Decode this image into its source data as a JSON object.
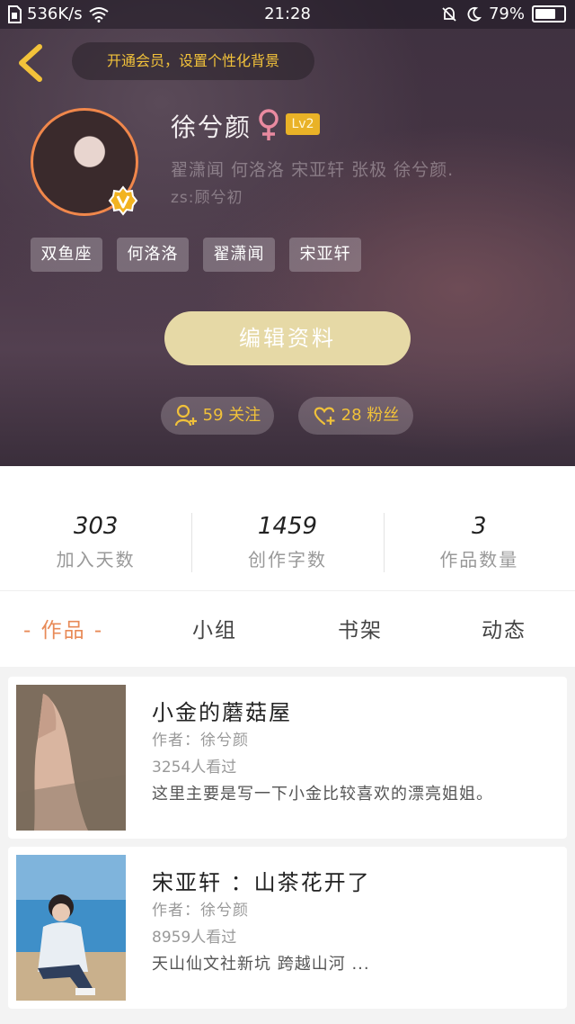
{
  "status_bar": {
    "speed": "536K/s",
    "time": "21:28",
    "battery": "79%",
    "battery_level": 0.79
  },
  "header": {
    "vip_text": "开通会员，设置个性化背景"
  },
  "profile": {
    "name": "徐兮颜",
    "level": "Lv2",
    "signature_line1": "翟潇闻 何洛洛 宋亚轩 张极 徐兮颜.",
    "signature_line2": "zs:顾兮初",
    "tags": [
      "双鱼座",
      "何洛洛",
      "翟潇闻",
      "宋亚轩"
    ],
    "edit_label": "编辑资料",
    "follow_label": "59 关注",
    "fans_label": "28 粉丝"
  },
  "stats": [
    {
      "value": "303",
      "label": "加入天数"
    },
    {
      "value": "1459",
      "label": "创作字数"
    },
    {
      "value": "3",
      "label": "作品数量"
    }
  ],
  "tabs": {
    "works": "- 作品 -",
    "group": "小组",
    "shelf": "书架",
    "moments": "动态"
  },
  "works": [
    {
      "title": "小金的蘑菇屋",
      "author": "作者：徐兮颜",
      "views": "3254人看过",
      "desc": "这里主要是写一下小金比较喜欢的漂亮姐姐。"
    },
    {
      "title": "宋亚轩 ：山茶花开了",
      "author": "作者：徐兮颜",
      "views": "8959人看过",
      "desc": "天山仙文社新坑 跨越山河 ..."
    }
  ],
  "colors": {
    "accent": "#e88a57",
    "gold": "#f0c13a",
    "edit_button": "#e6d9a6",
    "level_badge": "#e9b227"
  },
  "icons": [
    "back-arrow-icon",
    "female-icon",
    "vip-badge-icon",
    "add-user-icon",
    "heart-plus-icon",
    "wifi-icon",
    "bell-off-icon",
    "moon-icon"
  ]
}
